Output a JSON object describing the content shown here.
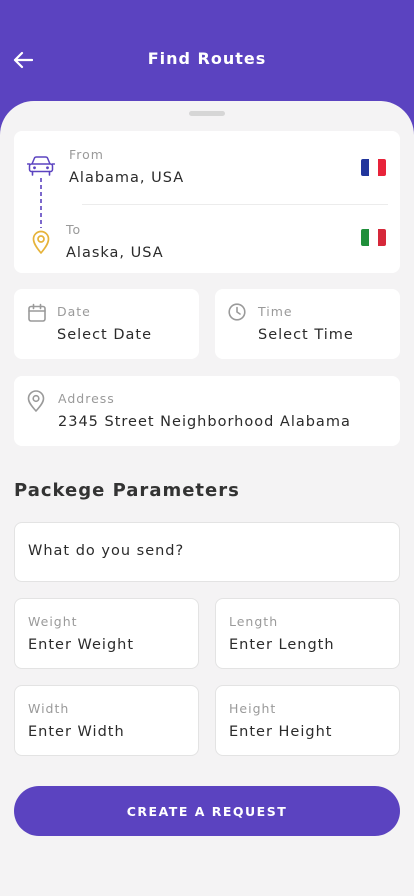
{
  "header": {
    "title": "Find Routes"
  },
  "route": {
    "from_label": "From",
    "from_value": "Alabama, USA",
    "to_label": "To",
    "to_value": "Alaska, USA"
  },
  "date": {
    "label": "Date",
    "value": "Select Date"
  },
  "time": {
    "label": "Time",
    "value": "Select Time"
  },
  "address": {
    "label": "Address",
    "value": "2345 Street Neighborhood Alabama"
  },
  "params": {
    "title": "Packege Parameters",
    "send_placeholder": "What do you send?",
    "weight": {
      "label": "Weight",
      "value": "Enter Weight"
    },
    "length": {
      "label": "Length",
      "value": "Enter Length"
    },
    "width": {
      "label": "Width",
      "value": "Enter Width"
    },
    "height": {
      "label": "Height",
      "value": "Enter Height"
    }
  },
  "cta": {
    "label": "CREATE A REQUEST"
  },
  "icons": {
    "back": "arrow-left-icon",
    "from": "car-icon",
    "to": "location-pin-icon",
    "date": "calendar-icon",
    "time": "clock-icon",
    "address": "location-pin-icon",
    "from_flag": "france-flag-icon",
    "to_flag": "italy-flag-icon"
  },
  "colors": {
    "primary": "#5b43c0",
    "background": "#f4f3f4",
    "pin_yellow": "#e6b33a",
    "france_blue": "#21359c",
    "france_red": "#e8233a",
    "italy_green": "#1f8f3a",
    "italy_red": "#d6283a"
  }
}
